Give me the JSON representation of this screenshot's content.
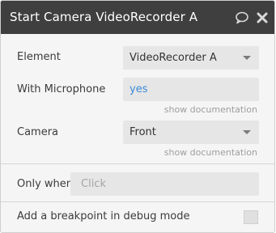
{
  "window": {
    "title": "Start Camera VideoRecorder A",
    "icons": [
      "comment-icon",
      "close-icon"
    ]
  },
  "element": {
    "label": "Element",
    "value": "VideoRecorder A"
  },
  "microphone": {
    "label": "With Microphone",
    "value": "yes",
    "doc_link": "show documentation"
  },
  "camera": {
    "label": "Camera",
    "value": "Front",
    "doc_link": "show documentation"
  },
  "only_when": {
    "label": "Only when",
    "placeholder": "Click"
  },
  "breakpoint": {
    "label": "Add a breakpoint in debug mode",
    "checked": false
  },
  "colors": {
    "titlebar": "#3f3f3f",
    "panel": "#f5f5f5",
    "field": "#e6e6e6",
    "accent_text": "#3b8bd6"
  }
}
